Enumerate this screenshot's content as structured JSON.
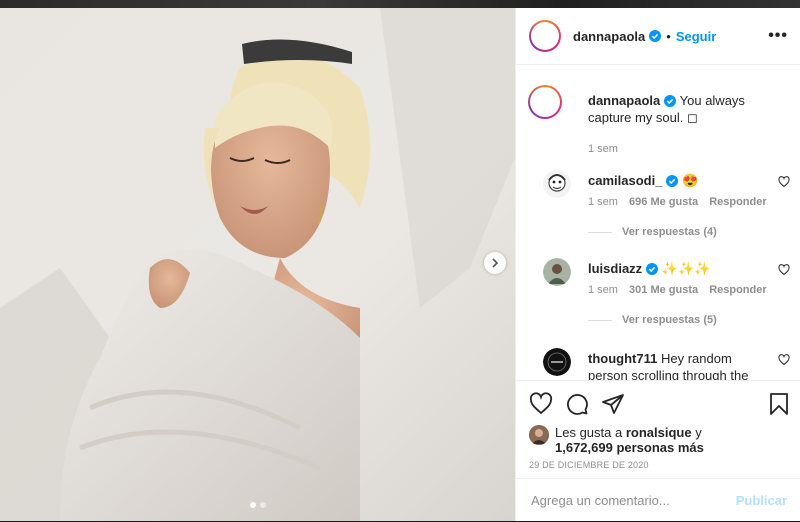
{
  "post": {
    "author": "dannapaola",
    "follow_label": "Seguir",
    "separator": "•",
    "more_label": "•••"
  },
  "caption": {
    "username": "dannapaola",
    "text": "You always capture my soul. ◻",
    "time": "1 sem"
  },
  "comments": [
    {
      "username": "camilasodi_",
      "text": "😍",
      "time": "1 sem",
      "likes": "696 Me gusta",
      "reply": "Responder",
      "replies": "Ver respuestas (4)"
    },
    {
      "username": "luisdiazz",
      "text": "✨✨✨",
      "time": "1 sem",
      "likes": "301 Me gusta",
      "reply": "Responder",
      "replies": "Ver respuestas (5)"
    },
    {
      "username": "thought711",
      "text": "Hey random person scrolling through the"
    }
  ],
  "likes": {
    "prefix": "Les gusta a",
    "user": "ronalsique",
    "joiner": "y",
    "count": "1,672,699 personas más"
  },
  "date": "29 DE DICIEMBRE DE 2020",
  "add_comment": {
    "placeholder": "Agrega un comentario...",
    "publish": "Publicar"
  },
  "colors": {
    "accent": "#0095f6",
    "publish_disabled": "#b2dffc",
    "muted": "#8e8e8e"
  },
  "carousel": {
    "current": 1,
    "total": 2
  }
}
